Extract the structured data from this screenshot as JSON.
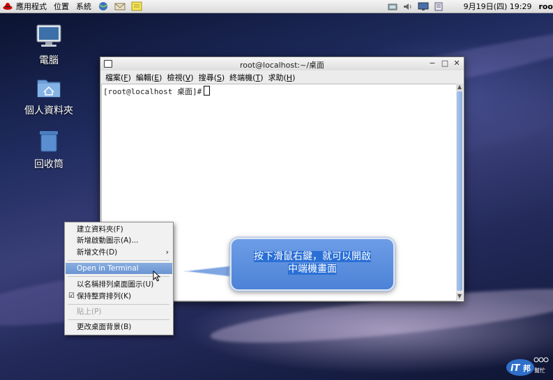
{
  "panel": {
    "menus": [
      "應用程式",
      "位置",
      "系統"
    ],
    "clock": "9月19日(四) 19:29",
    "user": "roo"
  },
  "desktop_icons": [
    {
      "label": "電腦",
      "icon": "computer-icon"
    },
    {
      "label": "個人資料夾",
      "icon": "home-folder-icon"
    },
    {
      "label": "回收筒",
      "icon": "trash-icon"
    }
  ],
  "terminal": {
    "title": "root@localhost:~/桌面",
    "menus": [
      {
        "label": "檔案(",
        "key": "F",
        "end": ")"
      },
      {
        "label": "編輯(",
        "key": "E",
        "end": ")"
      },
      {
        "label": "檢視(",
        "key": "V",
        "end": ")"
      },
      {
        "label": "搜尋(",
        "key": "S",
        "end": ")"
      },
      {
        "label": "終端機(",
        "key": "T",
        "end": ")"
      },
      {
        "label": "求助(",
        "key": "H",
        "end": ")"
      }
    ],
    "prompt": "[root@localhost 桌面]#"
  },
  "context_menu": {
    "items": [
      {
        "label": "建立資料夾(F)"
      },
      {
        "label": "新增啟動圖示(A)..."
      },
      {
        "label": "新增文件(D)"
      },
      {
        "label": "Open in Terminal"
      },
      {
        "label": "以名稱排列桌面圖示(U)"
      },
      {
        "label": "保持整齊排列(K)"
      },
      {
        "label": "貼上(P)"
      },
      {
        "label": "更改桌面背景(B)"
      }
    ]
  },
  "callout": {
    "line1": "按下滑鼠右鍵，就可以開啟",
    "line2": "中端機畫面"
  },
  "watermark": {
    "text": "iT邦幫忙"
  }
}
